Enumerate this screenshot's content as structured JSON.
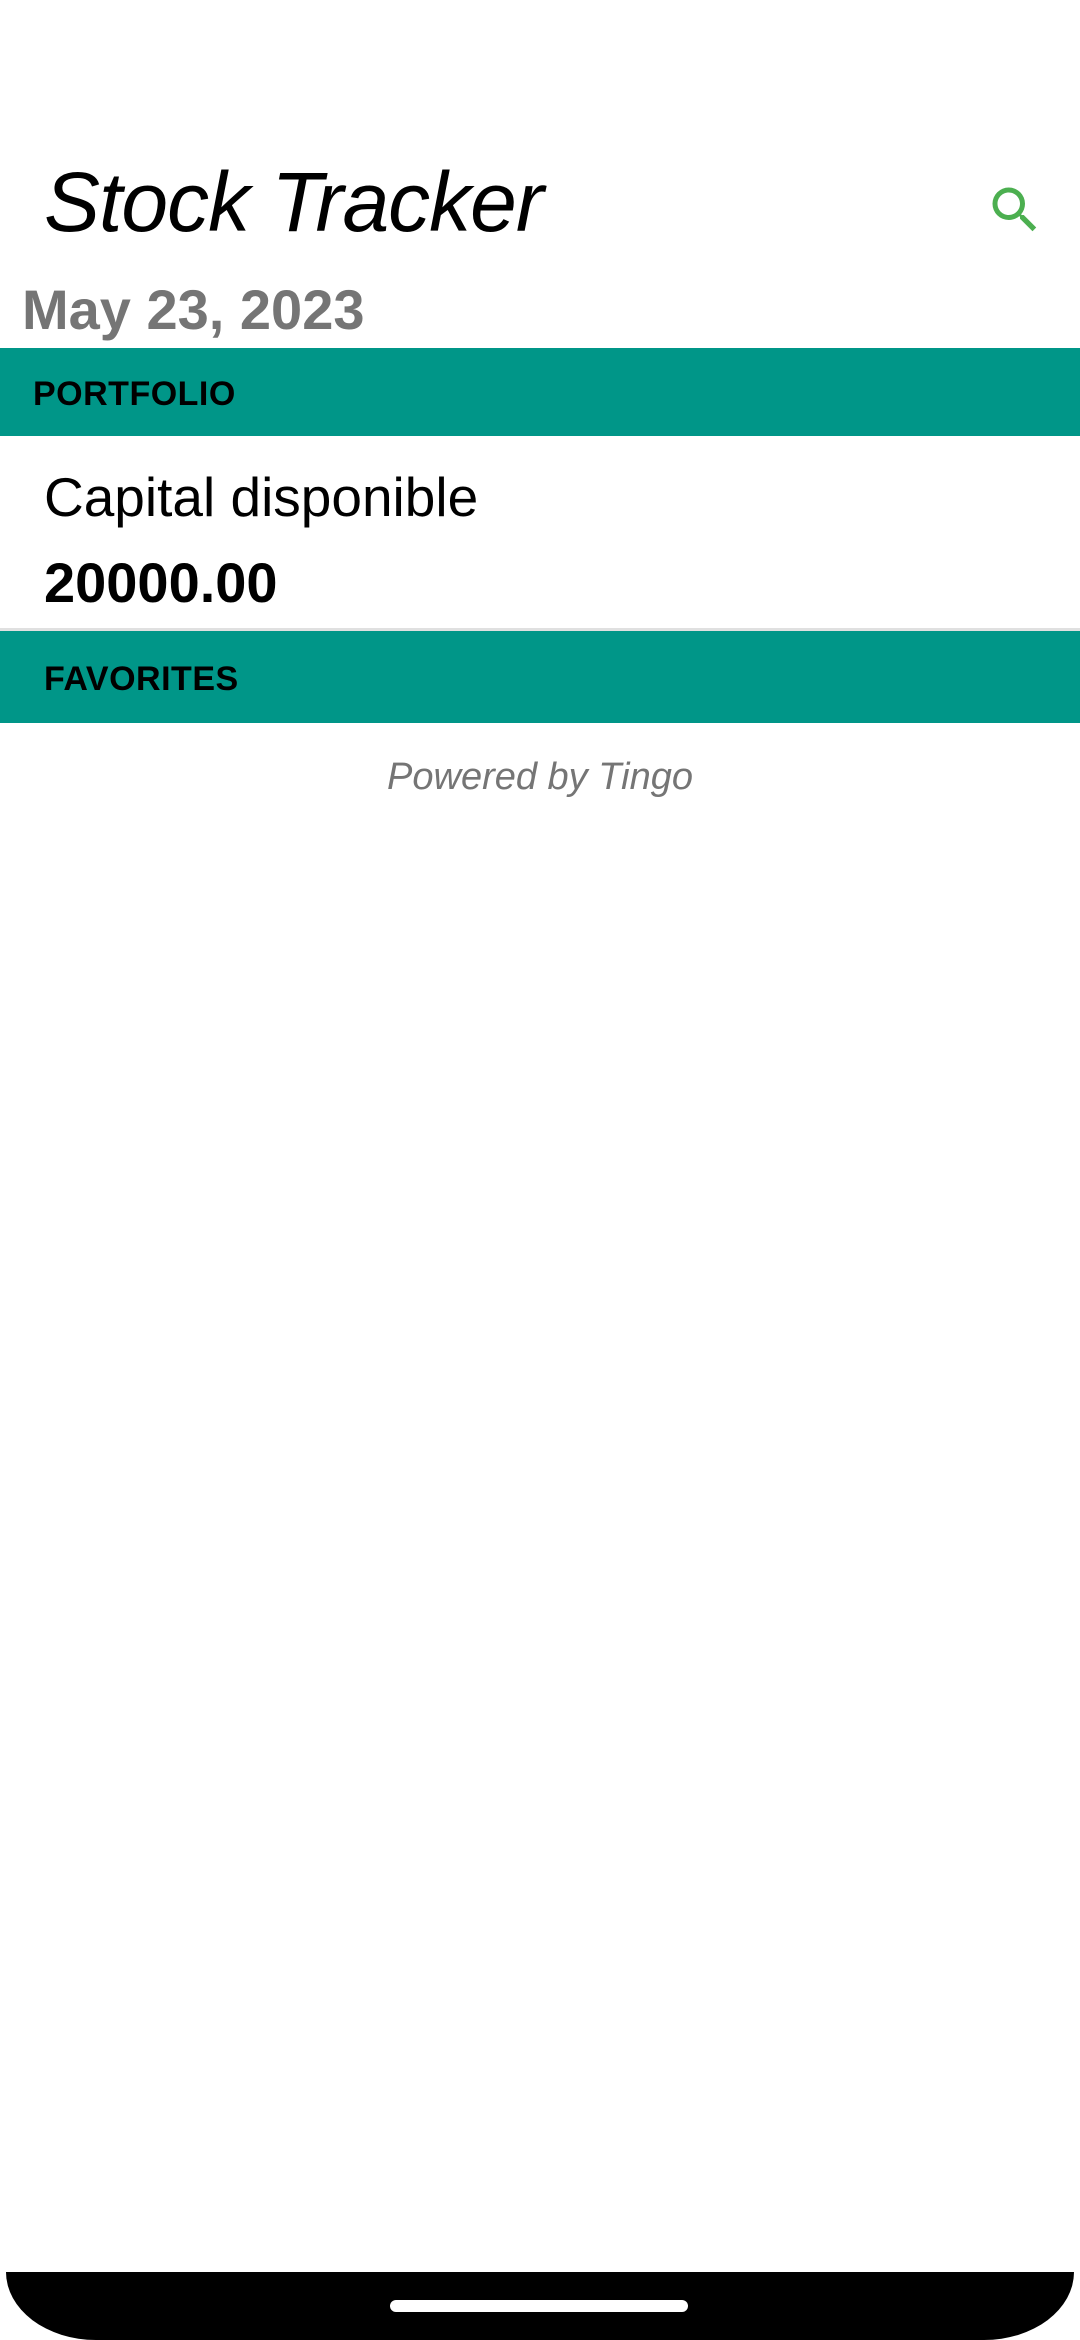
{
  "app": {
    "title": "Stock Tracker",
    "search_icon": "search-icon",
    "accent_color": "#4CAF50"
  },
  "date": "May 23, 2023",
  "portfolio": {
    "header": "PORTFOLIO",
    "header_color": "#009688",
    "capital_label": "Capital disponible",
    "capital_value": "20000.00"
  },
  "favorites": {
    "header": "FAVORITES",
    "header_color": "#009688"
  },
  "footer": {
    "powered_by": "Powered by Tingo"
  }
}
